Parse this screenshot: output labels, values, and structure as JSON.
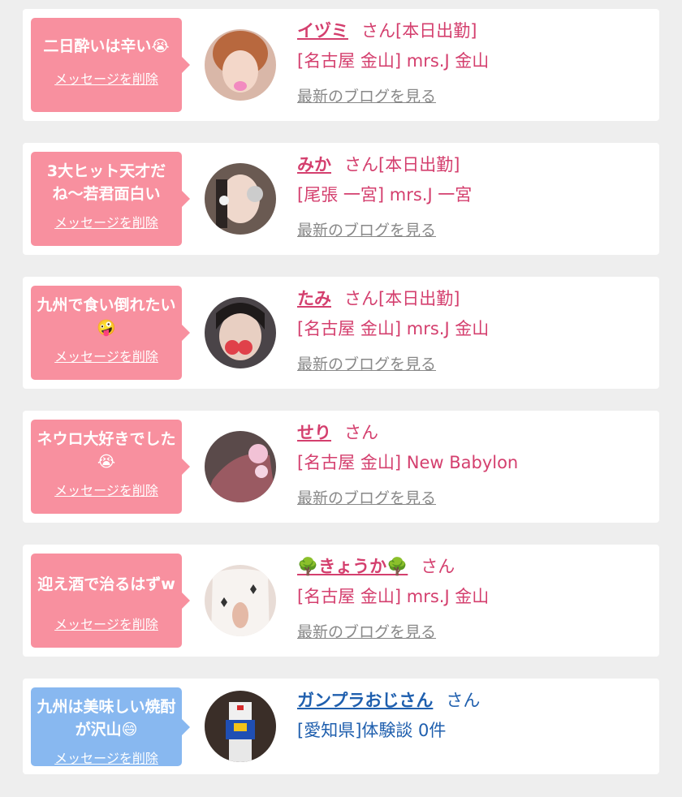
{
  "delete_label": "メッセージを削除",
  "blog_label": "最新のブログを見る",
  "san": "さん",
  "cards": [
    {
      "message": "二日酔いは辛い😭",
      "name": "イヅミ",
      "status": "[本日出勤]",
      "shop": "[名古屋 金山] mrs.J 金山"
    },
    {
      "message": "3大ヒット天才だね〜若君面白い",
      "name": "みか",
      "status": "[本日出勤]",
      "shop": "[尾張 一宮] mrs.J 一宮"
    },
    {
      "message": "九州で食い倒れたい🤪",
      "name": "たみ",
      "status": "[本日出勤]",
      "shop": "[名古屋 金山] mrs.J 金山"
    },
    {
      "message": "ネウロ大好きでした😭",
      "name": "せり",
      "status": "",
      "shop": "[名古屋 金山] New Babylon"
    },
    {
      "message": "迎え酒で治るはずw",
      "name": "🌳きょうか🌳",
      "status": "",
      "shop": "[名古屋 金山] mrs.J 金山"
    },
    {
      "message": "九州は美味しい焼酎が沢山😄",
      "name": "ガンプラおじさん",
      "status": "",
      "shop": "[愛知県]体験談 0件"
    }
  ],
  "colors": {
    "pink_bubble": "#f8909f",
    "blue_bubble": "#88b8f0",
    "pink_text": "#d43f6e",
    "blue_text": "#1f5fae"
  }
}
